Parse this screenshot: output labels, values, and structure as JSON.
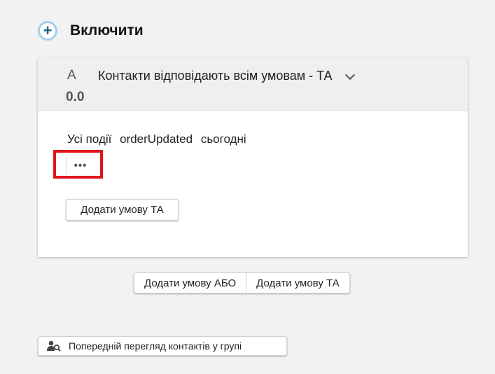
{
  "include": {
    "icon": "plus-icon",
    "title": "Включити"
  },
  "rule_card": {
    "letter": "A",
    "score": "0.0",
    "match_select": {
      "label": "Контакти відповідають всім умовам - ТА",
      "icon": "chevron-down-icon"
    },
    "condition": {
      "words": [
        "Усі події",
        "orderUpdated",
        "сьогодні"
      ]
    },
    "more_button": {
      "icon": "ellipsis-icon",
      "label": "•••"
    },
    "add_and_inner_label": "Додати умову ТА"
  },
  "outer_buttons": {
    "add_or_label": "Додати умову АБО",
    "add_and_label": "Додати умову ТА"
  },
  "preview": {
    "icon": "user-search-icon",
    "label": "Попередній перегляд контактів у групі"
  },
  "colors": {
    "highlight": "#e0141b",
    "plus_ring": "#9fd0ec",
    "plus_glyph": "#1d5f88",
    "background": "#f2f2f2"
  }
}
